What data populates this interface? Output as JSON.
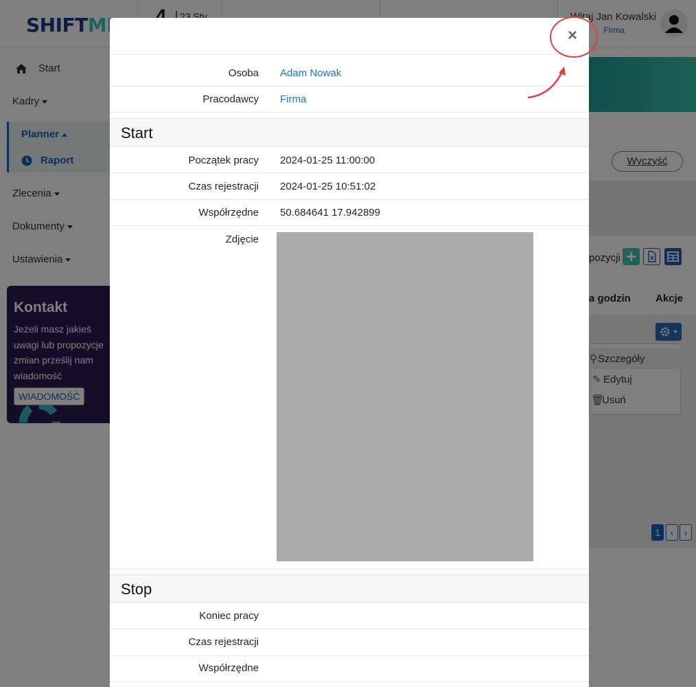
{
  "topbar": {
    "logo_part1": "SHIFT",
    "logo_part2": "ME",
    "date_day": "4",
    "date_month": "23 Sty",
    "greeting": "Witaj Jan Kowalski",
    "company": "Firma"
  },
  "sidebar": {
    "start": "Start",
    "kadry": "Kadry",
    "planner": "Planner",
    "raport": "Raport",
    "zlecenia": "Zlecenia",
    "dokumenty": "Dokumenty",
    "ustawienia": "Ustawienia"
  },
  "contact": {
    "title": "Kontakt",
    "text": "Jeżeli masz jakieś uwagi lub propozycje zmian prześlij nam wiadomość",
    "button": "WIADOMOŚĆ"
  },
  "main": {
    "clear_button": "Wyczyść",
    "proposals_label": "pozycji",
    "column_hours": "a godzin",
    "column_actions": "Akcje",
    "dropdown": {
      "details": "Szczegóły",
      "edit": "Edytuj",
      "delete": "Usuń"
    },
    "pager_current": "1"
  },
  "modal": {
    "close_symbol": "×",
    "person_label": "Osoba",
    "person_value": "Adam Nowak",
    "employers_label": "Pracodawcy",
    "employers_value": "Firma",
    "start_section": "Start",
    "start_work_label": "Początek pracy",
    "start_work_value": "2024-01-25 11:00:00",
    "start_reg_label": "Czas rejestracji",
    "start_reg_value": "2024-01-25 10:51:02",
    "start_coords_label": "Współrzędne",
    "start_coords_value": "50.684641 17.942899",
    "photo_label": "Zdjęcie",
    "stop_section": "Stop",
    "stop_work_label": "Koniec pracy",
    "stop_reg_label": "Czas rejestracji",
    "stop_coords_label": "Współrzędne"
  },
  "colors": {
    "accent": "#1a6fd6",
    "brand_dark": "#1a3a8a",
    "brand_teal": "#3cc6b4",
    "annotation": "#e53e3e"
  }
}
